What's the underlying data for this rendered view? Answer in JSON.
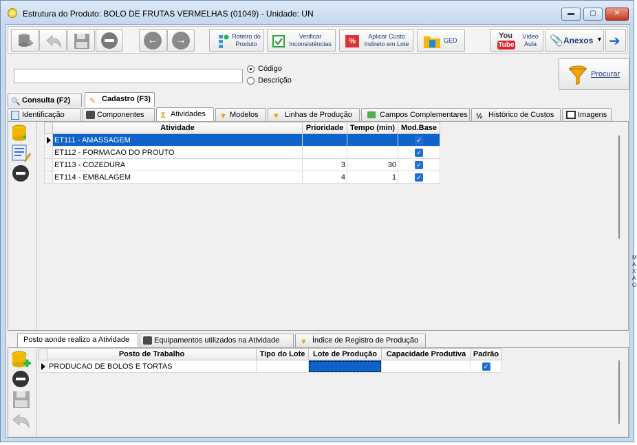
{
  "window": {
    "title": "Estrutura do Produto: BOLO DE FRUTAS VERMELHAS  (01049)  - Unidade: UN",
    "min_label": "▬",
    "max_label": "▢",
    "close_label": "✕"
  },
  "toolbar": {
    "roteiro": "Roteiro do Produto",
    "verificar": "Verificar Inconsistências",
    "aplicar": "Aplicar Custo Indireto em Lote",
    "ged": "GED",
    "video": "Vídeo Aula",
    "youtube_top": "You",
    "youtube_bottom": "Tube",
    "anexos": "Anexos",
    "percent": "%"
  },
  "search": {
    "value": "",
    "radio_codigo": "Código",
    "radio_descricao": "Descrição",
    "selected": "Código",
    "procurar": "Procurar"
  },
  "main_tabs": [
    {
      "label": "Consulta (F2)"
    },
    {
      "label": "Cadastro (F3)"
    }
  ],
  "sub_tabs": [
    {
      "label": "Identificação"
    },
    {
      "label": "Componentes"
    },
    {
      "label": "Atividades"
    },
    {
      "label": "Modelos"
    },
    {
      "label": "Linhas de Produção"
    },
    {
      "label": "Campos Complementares"
    },
    {
      "label": "Histórico de Custos"
    },
    {
      "label": "Imagens"
    }
  ],
  "atividades": {
    "columns": [
      "Atividade",
      "Prioridade",
      "Tempo (min)",
      "Mod.Base"
    ],
    "rows": [
      {
        "atividade": "ET111 - AMASSAGEM",
        "prioridade": "",
        "tempo": "",
        "mod_base": true
      },
      {
        "atividade": "ET112 - FORMACAO DO PROUTO",
        "prioridade": "",
        "tempo": "",
        "mod_base": true
      },
      {
        "atividade": "ET113 - COZEDURA",
        "prioridade": "3",
        "tempo": "30",
        "mod_base": true
      },
      {
        "atividade": "ET114 - EMBALAGEM",
        "prioridade": "4",
        "tempo": "1",
        "mod_base": true
      }
    ]
  },
  "bottom_tabs": [
    {
      "label": "Posto aonde realizo a Atividade"
    },
    {
      "label": "Equipamentos utilizados na Atividade"
    },
    {
      "label": "Índice de Registro de Produção"
    }
  ],
  "postos": {
    "columns": [
      "Posto de Trabalho",
      "Tipo do Lote",
      "Lote de Produção",
      "Capacidade Produtiva",
      "Padrão"
    ],
    "rows": [
      {
        "posto": "PRODUCAO DE BOLOS E TORTAS",
        "tipo_lote": "",
        "lote_producao": "",
        "capacidade": "",
        "padrao": true
      }
    ]
  },
  "side_marks": "M\nA\nX\nA\nO",
  "check_glyph": "✓"
}
